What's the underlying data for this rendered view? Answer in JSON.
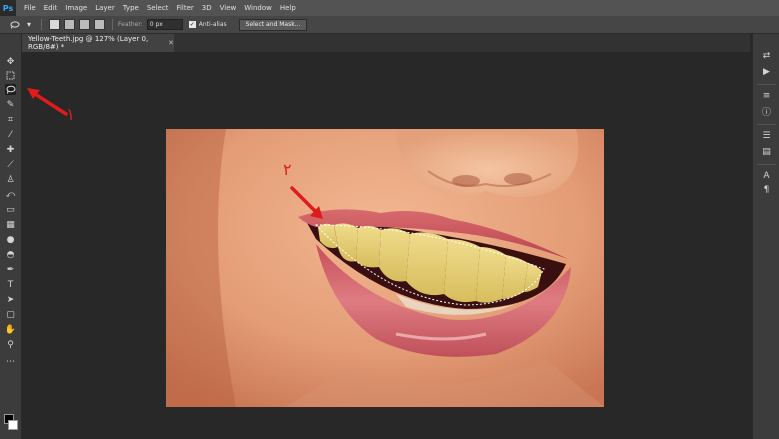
{
  "app": {
    "logo": "Ps"
  },
  "menu": [
    "File",
    "Edit",
    "Image",
    "Layer",
    "Type",
    "Select",
    "Filter",
    "3D",
    "View",
    "Window",
    "Help"
  ],
  "options": {
    "feather_label": "Feather:",
    "feather_value": "0 px",
    "antialias_label": "Anti-alias",
    "select_mask_label": "Select and Mask..."
  },
  "document": {
    "tab_title": "Yellow-Teeth.jpg @ 127% (Layer 0, RGB/8#) *"
  },
  "annotations": {
    "one": "۱",
    "two": "۲"
  },
  "colors": {
    "accent": "#31a8ff",
    "arrow": "#e01b1b",
    "teeth": "#e7d17a",
    "lips": "#c9525a",
    "skin": "#e7a47f"
  },
  "tools": [
    "move-icon",
    "marquee-icon",
    "lasso-icon",
    "quick-select-icon",
    "crop-icon",
    "eyedropper-icon",
    "healing-icon",
    "brush-icon",
    "stamp-icon",
    "history-brush-icon",
    "eraser-icon",
    "gradient-icon",
    "blur-icon",
    "dodge-icon",
    "pen-icon",
    "type-icon",
    "path-select-icon",
    "shape-icon",
    "hand-icon",
    "zoom-icon"
  ]
}
